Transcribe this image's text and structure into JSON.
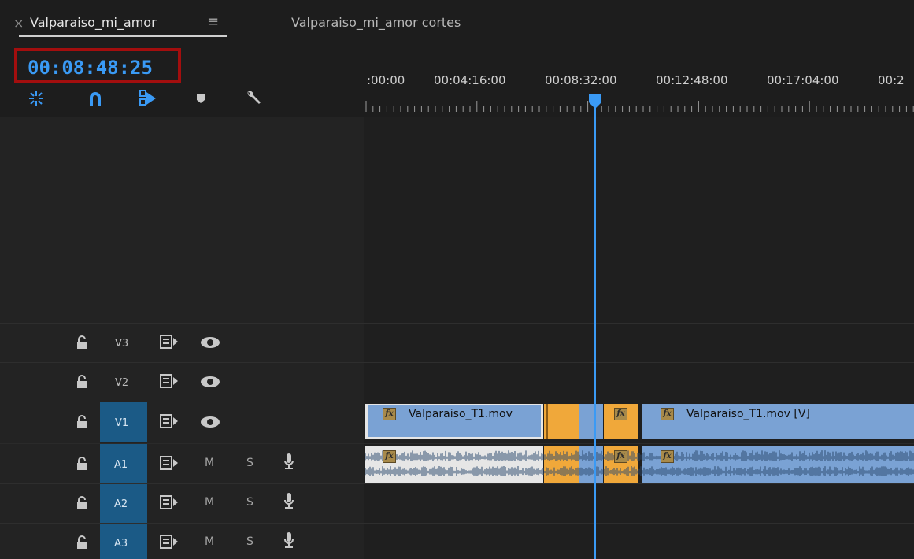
{
  "tabs": {
    "close": "×",
    "active_label": "Valparaiso_mi_amor",
    "menu": "≡",
    "inactive_label": "Valparaiso_mi_amor cortes"
  },
  "timecode": "00:08:48:25",
  "tools": {
    "insert_nest": "snap-nest-icon",
    "snap": "magnet-icon",
    "linked_selection": "linked-selection-icon",
    "add_marker": "marker-icon",
    "settings": "wrench-icon"
  },
  "ruler": {
    "labels": [
      ":00:00",
      "00:04:16:00",
      "00:08:32:00",
      "00:12:48:00",
      "00:17:04:00",
      "00:2"
    ]
  },
  "tracks": {
    "video": [
      {
        "label": "V3",
        "targeted": false
      },
      {
        "label": "V2",
        "targeted": false
      },
      {
        "label": "V1",
        "targeted": true
      }
    ],
    "audio": [
      {
        "label": "A1",
        "m": "M",
        "s": "S",
        "targeted": true
      },
      {
        "label": "A2",
        "m": "M",
        "s": "S",
        "targeted": true
      },
      {
        "label": "A3",
        "m": "M",
        "s": "S",
        "targeted": true
      }
    ]
  },
  "clips": {
    "v1_first": "Valparaiso_T1.mov",
    "v1_last": "Valparaiso_T1.mov [V]",
    "fx": "fx"
  },
  "colors": {
    "accent": "#3a9af5",
    "video_clip": "#7aa2d4",
    "orange_clip": "#f0a83a",
    "target_blue": "#1b5a86",
    "timecode_box": "#a30e0e"
  }
}
